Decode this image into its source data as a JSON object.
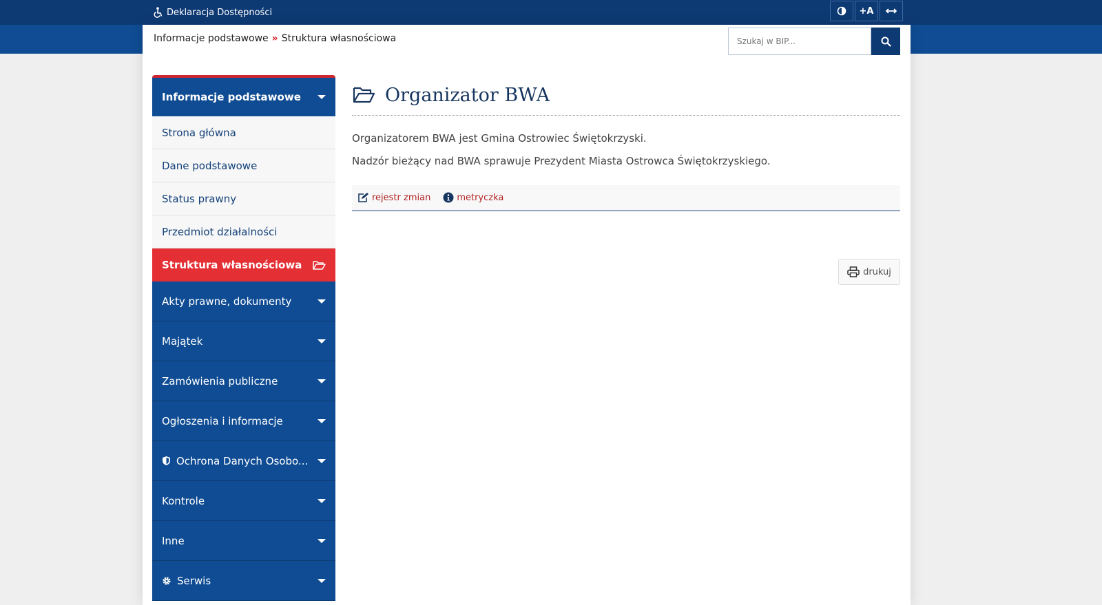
{
  "top_bar": {
    "accessibility_link": "Deklaracja Dostępności",
    "tools": {
      "text_size": "+A"
    }
  },
  "breadcrumb": {
    "items": [
      "Informacje podstawowe",
      "Struktura własnościowa"
    ],
    "separator": "»"
  },
  "search": {
    "placeholder": "Szukaj w BIP..."
  },
  "sidebar": {
    "header": "Informacje podstawowe",
    "sub_items": [
      "Strona główna",
      "Dane podstawowe",
      "Status prawny",
      "Przedmiot działalności"
    ],
    "active_item": "Struktura własnościowa",
    "nav_items": [
      {
        "label": "Akty prawne, dokumenty",
        "icon": ""
      },
      {
        "label": "Majątek",
        "icon": ""
      },
      {
        "label": "Zamówienia publiczne",
        "icon": ""
      },
      {
        "label": "Ogłoszenia i informacje",
        "icon": ""
      },
      {
        "label": "Ochrona Danych Osobo...",
        "icon": "shield-icon"
      },
      {
        "label": "Kontrole",
        "icon": ""
      },
      {
        "label": "Inne",
        "icon": ""
      },
      {
        "label": "Serwis",
        "icon": "gear-icon"
      }
    ]
  },
  "main": {
    "title": "Organizator BWA",
    "paragraphs": [
      "Organizatorem BWA jest Gmina Ostrowiec Świętokrzyski.",
      "Nadzór bieżący nad BWA sprawuje Prezydent Miasta Ostrowca Świętokrzyskiego."
    ],
    "meta_links": {
      "changes": "rejestr zmian",
      "metadata": "metryczka"
    },
    "print_label": "drukuj"
  },
  "colors": {
    "brand_blue": "#0f4c93",
    "dark_blue": "#0e3a74",
    "accent_red": "#e42f35",
    "link_red": "#b22222"
  }
}
